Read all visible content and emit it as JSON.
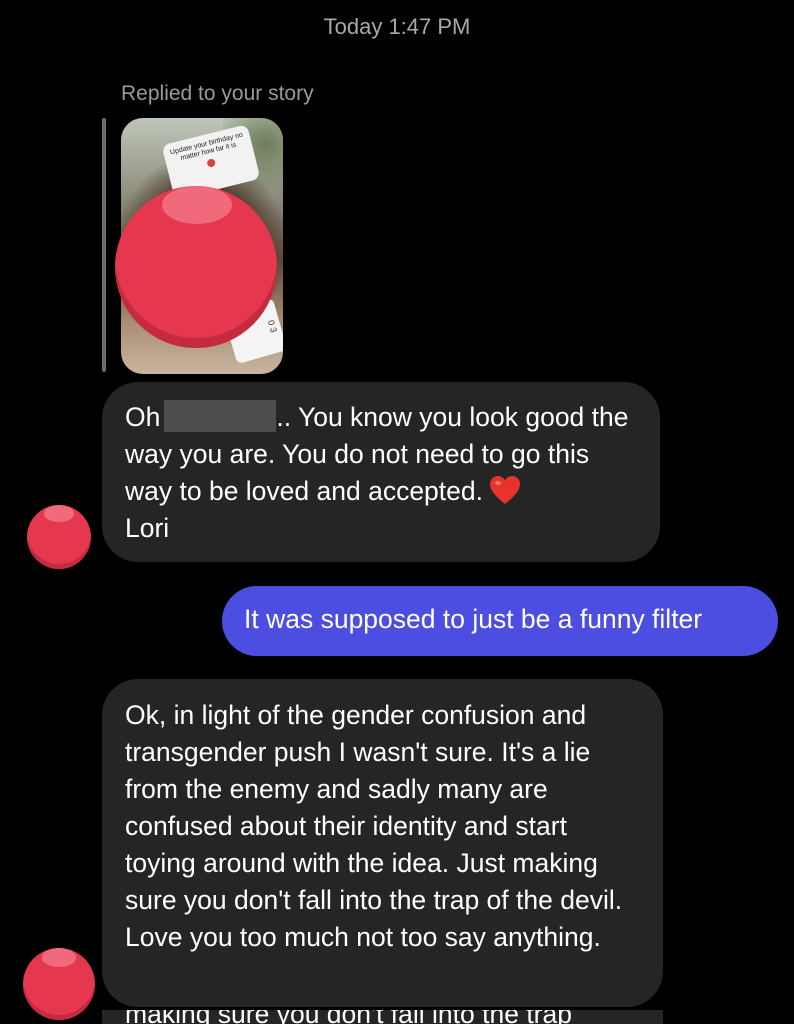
{
  "header": {
    "timestamp": "Today 1:47 PM"
  },
  "story_reply": {
    "label": "Replied to your story",
    "sticker_text": "Update your birthday no matter how far it is",
    "counter_text": "0 3"
  },
  "messages": [
    {
      "sender": "other",
      "parts": {
        "prefix": "Oh",
        "after_name": ".. You know you look good the way you are. You do not need to go this way to be loved and accepted.",
        "emoji": "heart-emoji",
        "signature": "Lori"
      }
    },
    {
      "sender": "me",
      "text": "It was supposed to just be a funny filter"
    },
    {
      "sender": "other",
      "text": "Ok, in light of the gender confusion and transgender push I wasn't sure. It's a lie from the enemy and sadly many are confused about their identity and start toying around with the idea. Just making sure you don't fall into the trap of the devil. Love you too much not too say anything."
    }
  ],
  "cutoff_line": "making sure you don't fall into the trap",
  "colors": {
    "background": "#000000",
    "incoming_bubble": "#252525",
    "outgoing_bubble": "#4b4ee0",
    "redaction_red": "#e5384f",
    "timestamp_gray": "#a9a9a9"
  }
}
